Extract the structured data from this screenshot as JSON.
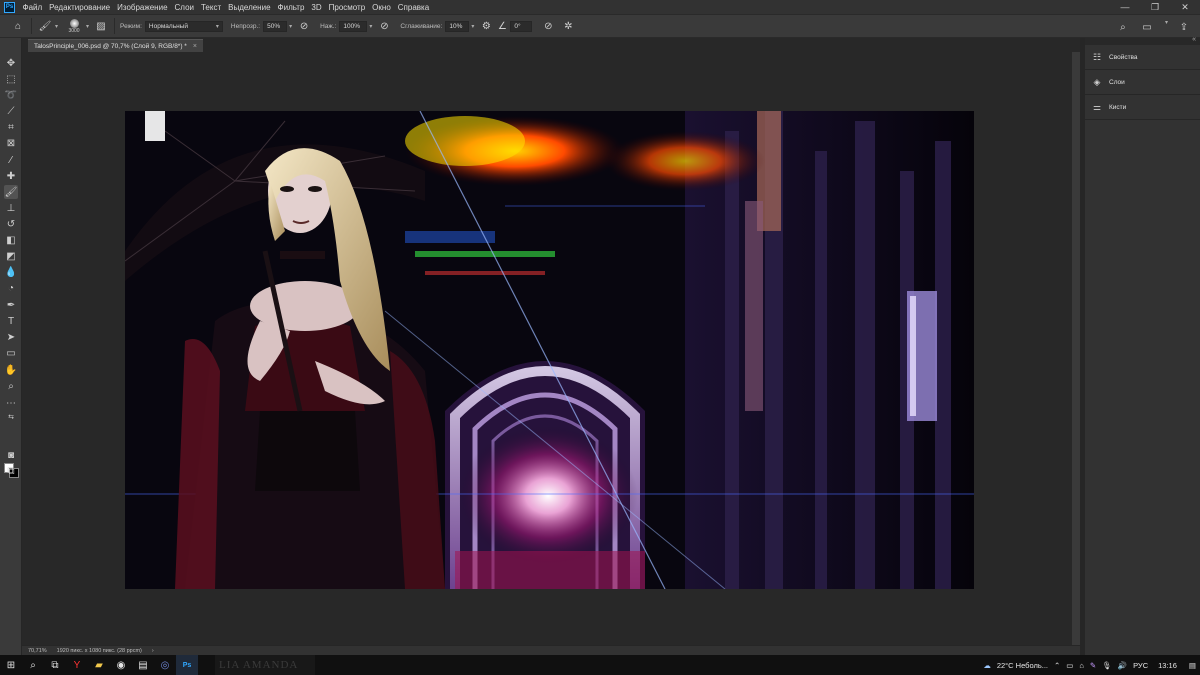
{
  "app": {
    "logo": "Ps"
  },
  "menu": [
    "Файл",
    "Редактирование",
    "Изображение",
    "Слои",
    "Текст",
    "Выделение",
    "Фильтр",
    "3D",
    "Просмотр",
    "Окно",
    "Справка"
  ],
  "window_controls": {
    "minimize": "—",
    "restore": "❐",
    "close": "✕"
  },
  "options": {
    "brush_size": "3000",
    "mode_label": "Режим:",
    "mode_value": "Нормальный",
    "opacity_label": "Непрозр.:",
    "opacity_value": "50%",
    "pressure_label": "Наж.:",
    "pressure_value": "100%",
    "smoothing_label": "Сглаживание:",
    "smoothing_value": "10%",
    "angle_value": "0°"
  },
  "tab": {
    "title": "TalosPrinciple_006.psd @ 70,7% (Слой 9, RGB/8*) *",
    "close": "×"
  },
  "status": {
    "zoom": "70,71%",
    "doc_info": "1920 пикс. x 1080 пикс. (28 ppcm)",
    "arrow": "›"
  },
  "panels": {
    "collapse": "«",
    "items": [
      {
        "label": "Свойства",
        "icon": "properties-icon"
      },
      {
        "label": "Слои",
        "icon": "layers-icon"
      },
      {
        "label": "Кисти",
        "icon": "brushes-icon"
      }
    ]
  },
  "taskbar": {
    "wallpaper_text": "LIA AMANDA",
    "weather": "22°C  Неболь...",
    "language": "РУС",
    "time": "13:16"
  },
  "colors": {
    "accent": "#31a8ff",
    "bg": "#323232",
    "canvas": "#282828"
  }
}
